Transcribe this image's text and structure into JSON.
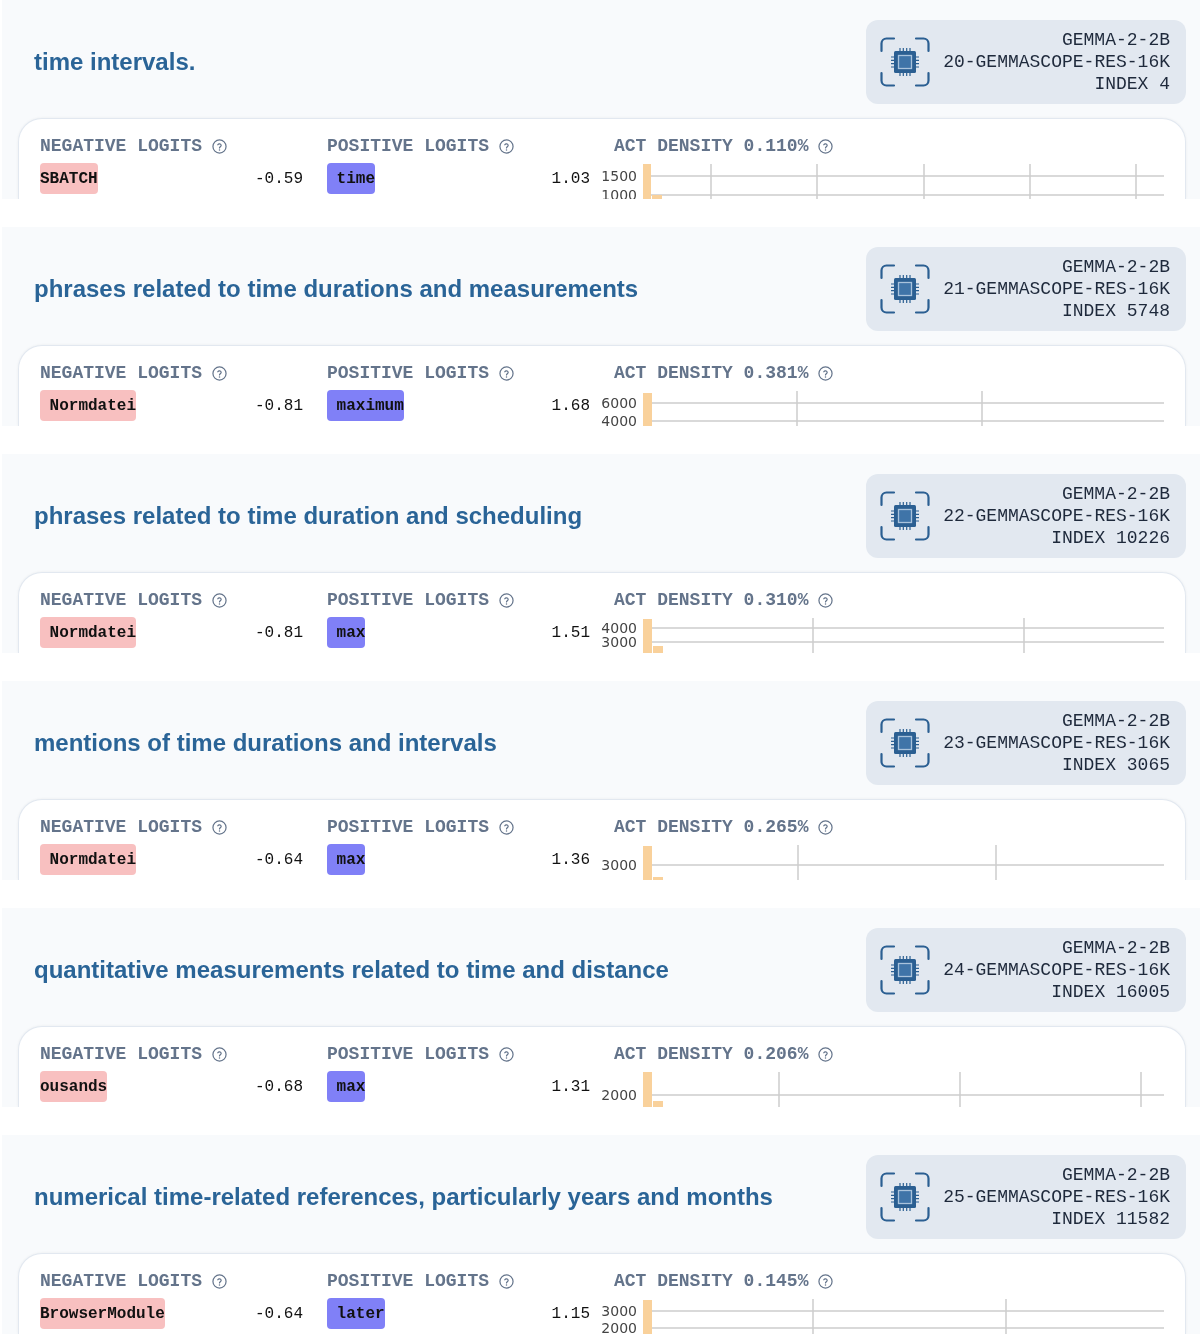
{
  "features": [
    {
      "title": "time intervals.",
      "badge": {
        "model": "GEMMA-2-2B",
        "source": "20-GEMMASCOPE-RES-16K",
        "index": "INDEX 4"
      },
      "negative": {
        "label": "NEGATIVE LOGITS",
        "token": "SBATCH",
        "value": "-0.59"
      },
      "positive": {
        "label": "POSITIVE LOGITS",
        "token": " time",
        "value": "1.03"
      },
      "density": {
        "label": "ACT DENSITY 0.110%",
        "histogram": {
          "y_tick_labels": [
            "1500",
            "1000"
          ]
        }
      }
    },
    {
      "title": "phrases related to time durations and measurements",
      "badge": {
        "model": "GEMMA-2-2B",
        "source": "21-GEMMASCOPE-RES-16K",
        "index": "INDEX 5748"
      },
      "negative": {
        "label": "NEGATIVE LOGITS",
        "token": " Normdatei",
        "value": "-0.81"
      },
      "positive": {
        "label": "POSITIVE LOGITS",
        "token": " maximum",
        "value": "1.68"
      },
      "density": {
        "label": "ACT DENSITY 0.381%",
        "histogram": {
          "y_tick_labels": [
            "6000",
            "4000"
          ]
        }
      }
    },
    {
      "title": "phrases related to time duration and scheduling",
      "badge": {
        "model": "GEMMA-2-2B",
        "source": "22-GEMMASCOPE-RES-16K",
        "index": "INDEX 10226"
      },
      "negative": {
        "label": "NEGATIVE LOGITS",
        "token": " Normdatei",
        "value": "-0.81"
      },
      "positive": {
        "label": "POSITIVE LOGITS",
        "token": " max",
        "value": "1.51"
      },
      "density": {
        "label": "ACT DENSITY 0.310%",
        "histogram": {
          "y_tick_labels": [
            "4000",
            "3000"
          ]
        }
      }
    },
    {
      "title": "mentions of time durations and intervals",
      "badge": {
        "model": "GEMMA-2-2B",
        "source": "23-GEMMASCOPE-RES-16K",
        "index": "INDEX 3065"
      },
      "negative": {
        "label": "NEGATIVE LOGITS",
        "token": " Normdatei",
        "value": "-0.64"
      },
      "positive": {
        "label": "POSITIVE LOGITS",
        "token": " max",
        "value": "1.36"
      },
      "density": {
        "label": "ACT DENSITY 0.265%",
        "histogram": {
          "y_tick_labels": [
            "3000"
          ]
        }
      }
    },
    {
      "title": "quantitative measurements related to time and distance",
      "badge": {
        "model": "GEMMA-2-2B",
        "source": "24-GEMMASCOPE-RES-16K",
        "index": "INDEX 16005"
      },
      "negative": {
        "label": "NEGATIVE LOGITS",
        "token": "ousands",
        "value": "-0.68"
      },
      "positive": {
        "label": "POSITIVE LOGITS",
        "token": " max",
        "value": "1.31"
      },
      "density": {
        "label": "ACT DENSITY 0.206%",
        "histogram": {
          "y_tick_labels": [
            "2000"
          ]
        }
      }
    },
    {
      "title": "numerical time-related references, particularly years and months",
      "badge": {
        "model": "GEMMA-2-2B",
        "source": "25-GEMMASCOPE-RES-16K",
        "index": "INDEX 11582"
      },
      "negative": {
        "label": "NEGATIVE LOGITS",
        "token": "BrowserModule",
        "value": "-0.64"
      },
      "positive": {
        "label": "POSITIVE LOGITS",
        "token": " later",
        "value": "1.15"
      },
      "density": {
        "label": "ACT DENSITY 0.145%",
        "histogram": {
          "y_tick_labels": [
            "3000",
            "2000"
          ]
        }
      }
    }
  ]
}
